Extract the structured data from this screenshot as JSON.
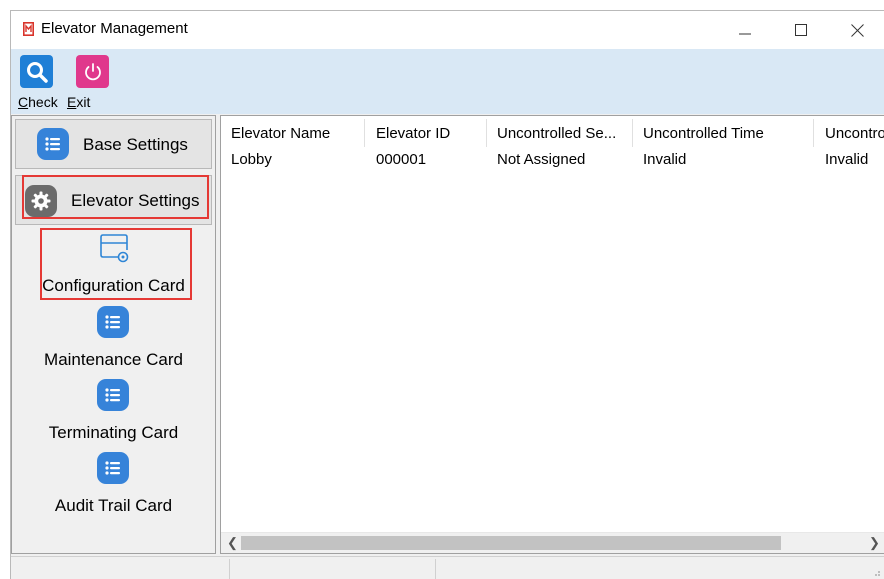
{
  "window": {
    "title": "Elevator Management",
    "controls": [
      "minimize-icon",
      "maximize-icon",
      "close-icon"
    ]
  },
  "toolbar": {
    "check_label": "Check",
    "exit_label": "Exit",
    "check_icon": "search-icon",
    "exit_icon": "power-icon"
  },
  "sidebar": {
    "groups": [
      {
        "label": "Base Settings",
        "icon": "list-icon"
      },
      {
        "label": "Elevator Settings",
        "icon": "gear-icon"
      }
    ],
    "items": [
      {
        "label": "Configuration Card",
        "icon": "card-gear-icon"
      },
      {
        "label": "Maintenance Card",
        "icon": "list-icon"
      },
      {
        "label": "Terminating Card",
        "icon": "list-icon"
      },
      {
        "label": "Audit Trail Card",
        "icon": "list-icon"
      }
    ]
  },
  "grid": {
    "columns": [
      "Elevator Name",
      "Elevator ID",
      "Uncontrolled Se...",
      "Uncontrolled Time",
      "Uncontro"
    ],
    "rows": [
      [
        "Lobby",
        "000001",
        "Not Assigned",
        "Invalid",
        "Invalid"
      ]
    ]
  },
  "colors": {
    "toolbar_bg": "#d9e8f5",
    "check_icon_bg": "#1f7fd6",
    "exit_icon_bg": "#e0388c",
    "nav_icon_bg": "#3683d9",
    "highlight_border": "#e53935"
  }
}
